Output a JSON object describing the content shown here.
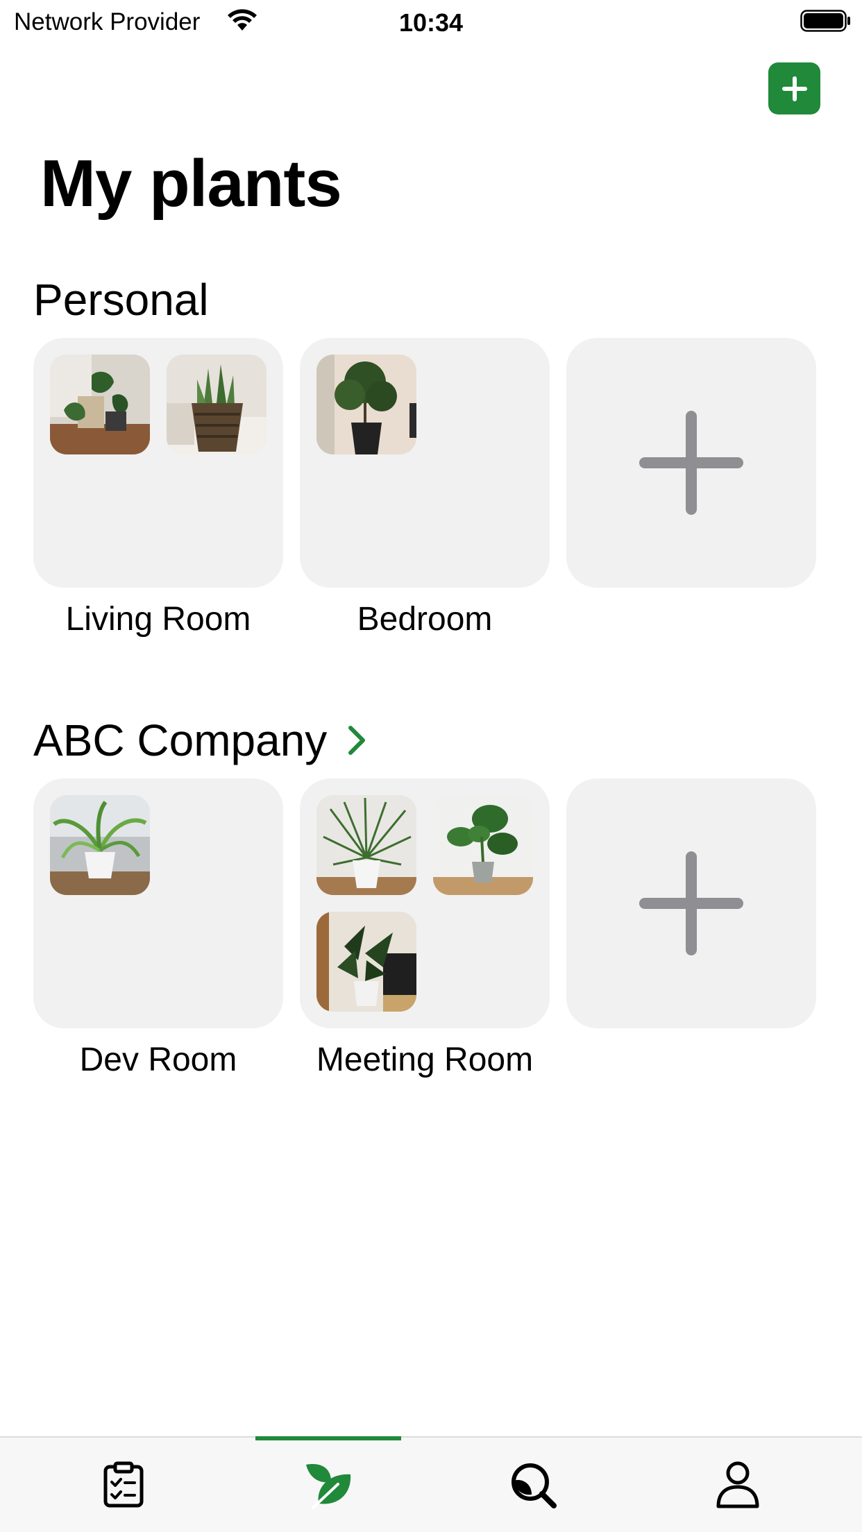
{
  "status_bar": {
    "carrier": "Network Provider",
    "time": "10:34"
  },
  "header": {
    "title": "My plants"
  },
  "sections": [
    {
      "title": "Personal",
      "has_chevron": false,
      "rooms": [
        {
          "label": "Living Room",
          "plant_count": 2
        },
        {
          "label": "Bedroom",
          "plant_count": 1
        }
      ]
    },
    {
      "title": "ABC Company",
      "has_chevron": true,
      "rooms": [
        {
          "label": "Dev Room",
          "plant_count": 1
        },
        {
          "label": "Meeting Room",
          "plant_count": 3
        }
      ]
    }
  ],
  "tab_bar": {
    "tabs": [
      {
        "icon": "tasks-clipboard-icon",
        "active": false
      },
      {
        "icon": "plant-leaf-icon",
        "active": true
      },
      {
        "icon": "plant-search-icon",
        "active": false
      },
      {
        "icon": "profile-icon",
        "active": false
      }
    ]
  },
  "colors": {
    "accent": "#20893a",
    "card_background": "#f1f1f1",
    "plus_gray": "#8e8e93"
  }
}
